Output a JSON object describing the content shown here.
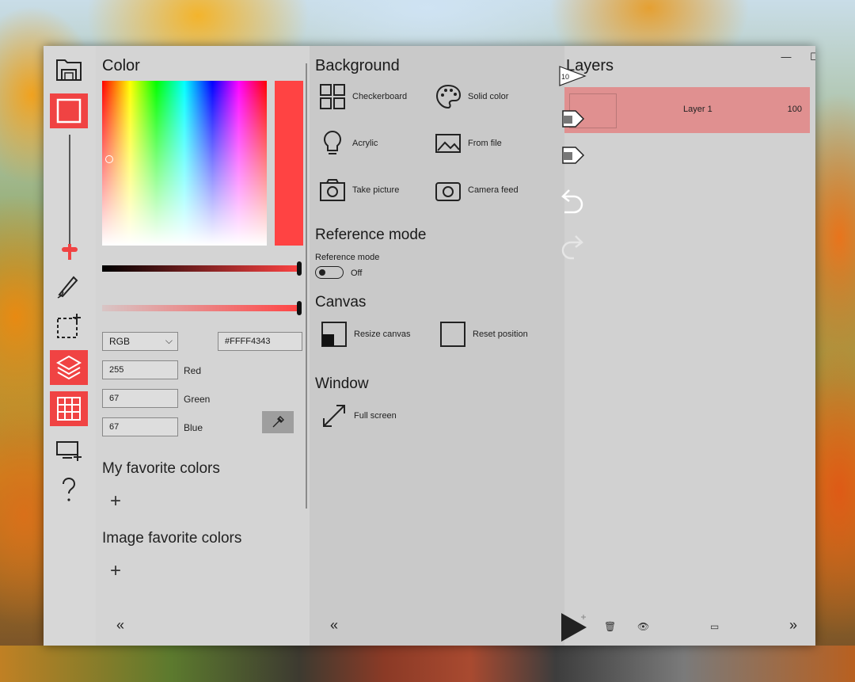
{
  "color_panel": {
    "title": "Color",
    "mode_select": "RGB",
    "hex_value": "#FFFF4343",
    "channels": [
      {
        "label": "Red",
        "value": "255"
      },
      {
        "label": "Green",
        "value": "67"
      },
      {
        "label": "Blue",
        "value": "67"
      }
    ],
    "my_favorites_title": "My favorite colors",
    "image_favorites_title": "Image favorite colors",
    "add_symbol": "+",
    "collapse_symbol": "«",
    "selected_color": "#FF4343"
  },
  "background_panel": {
    "title": "Background",
    "options": [
      {
        "label": "Checkerboard"
      },
      {
        "label": "Solid color"
      },
      {
        "label": "Acrylic"
      },
      {
        "label": "From file"
      },
      {
        "label": "Take picture"
      },
      {
        "label": "Camera feed"
      }
    ],
    "reference_title": "Reference mode",
    "reference_label": "Reference mode",
    "reference_state": "Off",
    "canvas_title": "Canvas",
    "resize_label": "Resize canvas",
    "reset_label": "Reset position",
    "window_title": "Window",
    "fullscreen_label": "Full screen",
    "collapse_symbol": "«"
  },
  "layers_panel": {
    "title": "Layers",
    "layers": [
      {
        "name": "Layer 1",
        "opacity": "100"
      }
    ],
    "badge": "10",
    "expand_symbol": "»"
  },
  "window_controls": {
    "minimize": "—",
    "maximize": "☐",
    "close": "✕"
  },
  "colors": {
    "accent": "#F04343",
    "layer_selected": "#E09090"
  }
}
